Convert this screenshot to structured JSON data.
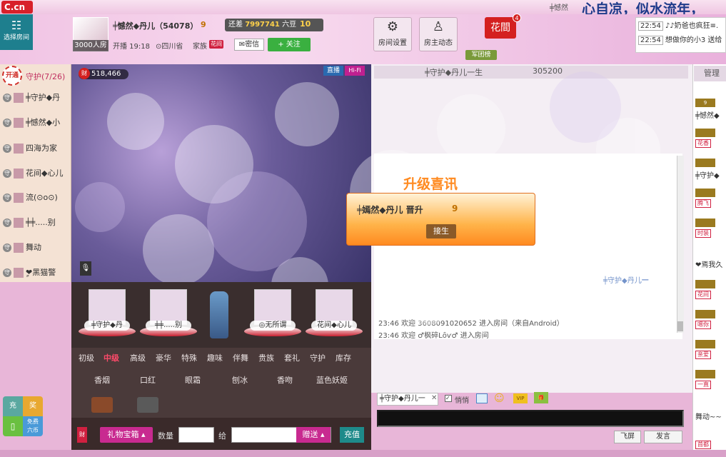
{
  "topbar": {
    "logo": "C.cn",
    "user_partial": "╪憾然",
    "banner": "心自凉，似水流年，"
  },
  "header": {
    "select_room": "选择房间",
    "room_count": "3000人房",
    "host_name": "╪憾然◆丹儿（54078）",
    "host_level": "9",
    "gap_label": "还差",
    "gap_value": "7997741",
    "gap_unit": "六豆",
    "gap_level": "10",
    "live_time": "开播 19:18",
    "location": "四川省",
    "family_label": "家族",
    "family_badge": "花间",
    "message_btn": "密信",
    "follow_btn": "+ 关注",
    "room_settings": "房间设置",
    "host_activity": "房主动态",
    "flower_room": "花間",
    "flower_count": "4",
    "army_rank": "军团榜"
  },
  "mini_chat": [
    {
      "time": "22:54",
      "text": "♪♪奶爸也疯狂≡."
    },
    {
      "time": "22:54",
      "text": "想做你的小3 送给"
    }
  ],
  "guards": {
    "open": "开通",
    "title": "守护(7/26)",
    "items": [
      {
        "name": "╪守护◆丹"
      },
      {
        "name": "╪憾然◆小"
      },
      {
        "name": "四海为家"
      },
      {
        "name": "花间◆心儿"
      },
      {
        "name": "流(⊙o⊙)"
      },
      {
        "name": "╪╪.....别"
      },
      {
        "name": "舞动"
      },
      {
        "name": "❤ٍ黑猫警"
      }
    ]
  },
  "video": {
    "wealth": "518,466",
    "wealth_icon": "财",
    "live_tag": "直播",
    "hifi_tag": "Hi-Fi"
  },
  "upgrade": {
    "title": "升级喜讯",
    "text": "╪嫣然◆丹儿  晋升",
    "level": "9",
    "button": "接生"
  },
  "seats": [
    {
      "name": "╪守护◆丹"
    },
    {
      "name": "╪╪.....别"
    },
    {
      "name": "◎无所谓"
    },
    {
      "name": "花间◆心儿"
    }
  ],
  "gift_tabs": [
    "初级",
    "中级",
    "高级",
    "豪华",
    "特殊",
    "趣味",
    "伴舞",
    "贵族",
    "套礼",
    "守护",
    "库存"
  ],
  "gifts": [
    "香烟",
    "口红",
    "眼霜",
    "刨冰",
    "香吻",
    "蓝色妖姬"
  ],
  "send_bar": {
    "tag": "财",
    "treasure": "礼物宝箱",
    "qty_label": "数量",
    "to_label": "给",
    "send": "赠送",
    "recharge": "充值"
  },
  "chat": {
    "tab_host": "╪守护◆丹儿一生",
    "tab_score": "305200",
    "lines": [
      "23:46 欢迎  3608091020652 进入房间（来自Android）",
      "23:46 欢迎 ♂枫碎Lȏѵ♂ 进入房间"
    ],
    "mention": "╪守护◆丹儿一",
    "target": "╪守护◆丹儿一",
    "target_close": "✕",
    "whisper": "悄悄",
    "fly_btn": "飞屏",
    "send_btn": "发言"
  },
  "admin": {
    "title": "管理",
    "items": [
      {
        "badge": "9",
        "text": "╪憾然◆"
      },
      {
        "badge": "",
        "tag": "花香"
      },
      {
        "badge": "",
        "text": "╪守护◆"
      },
      {
        "badge": "",
        "tag": "腾飞"
      },
      {
        "badge": "",
        "tag": "时装"
      },
      {
        "badge": "",
        "text": "❤焉我久"
      },
      {
        "badge": "",
        "tag": "花间"
      },
      {
        "badge": "",
        "tag": "嗯你"
      },
      {
        "badge": "",
        "tag": "亲爱"
      },
      {
        "badge": "",
        "tag": "一直"
      },
      {
        "badge": "",
        "text": "舞动~~"
      },
      {
        "badge": "",
        "tag": "首都"
      }
    ]
  },
  "bottom_buttons": {
    "charge": "充",
    "alert": "奖",
    "phone": "▯",
    "free": "免费",
    "six": "六币"
  },
  "colors": {
    "accent": "#c82a90",
    "teal": "#1e7f8e",
    "upgrade": "#ff8a20"
  }
}
